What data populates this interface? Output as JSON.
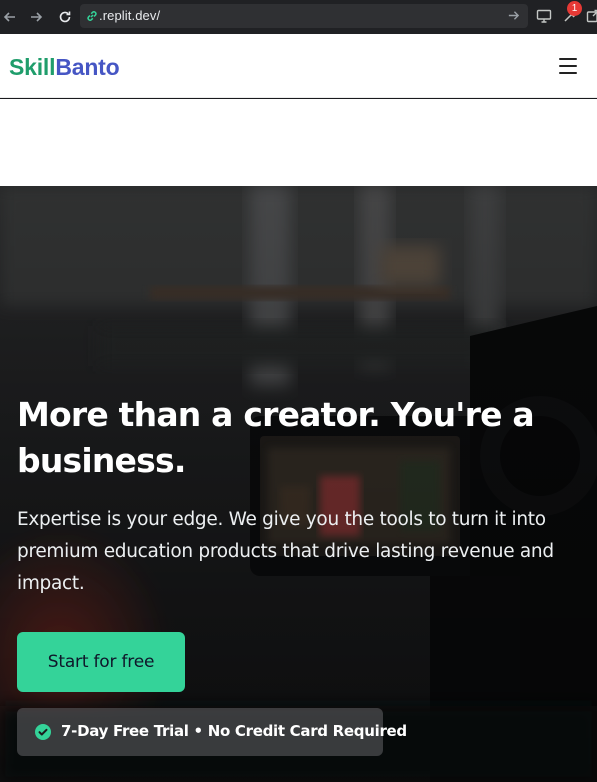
{
  "browser": {
    "url_dim": "",
    "url": ".replit.dev/",
    "notification_count": "1"
  },
  "header": {
    "brand_part1": "Skill",
    "brand_part2": "Banto"
  },
  "hero": {
    "title": "More than a creator. You're a business.",
    "subtitle": "Expertise is your edge. We give you the tools to turn it into premium education products that drive lasting revenue and impact.",
    "cta_label": "Start for free",
    "trial_note": "7-Day Free Trial • No Credit Card Required"
  },
  "colors": {
    "brand_green": "#1f9d6b",
    "brand_blue": "#4656c4",
    "cta_green": "#34d399"
  },
  "icons": [
    "back-arrow-icon",
    "forward-arrow-icon",
    "reload-icon",
    "link-icon",
    "go-arrow-icon",
    "monitor-icon",
    "wrench-icon",
    "external-icon",
    "menu-icon",
    "check-circle-icon"
  ]
}
